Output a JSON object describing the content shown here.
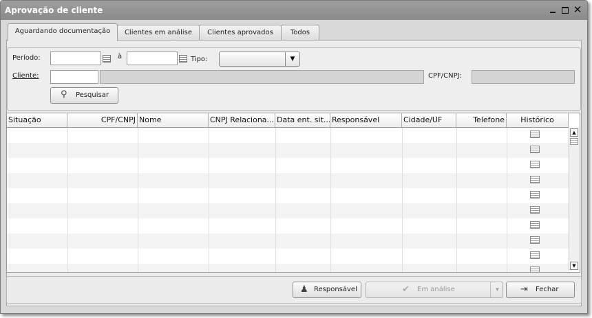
{
  "window": {
    "title": "Aprovação de cliente"
  },
  "tabs": [
    {
      "label": "Aguardando documentação",
      "active": true
    },
    {
      "label": "Clientes em análise"
    },
    {
      "label": "Clientes aprovados"
    },
    {
      "label": "Todos"
    }
  ],
  "filters": {
    "periodo_label": "Período:",
    "ate_label": "à",
    "tipo_label": "Tipo:",
    "cliente_label": "Cliente:",
    "cpfcnpj_label": "CPF/CNPJ:",
    "pesquisar_label": "Pesquisar"
  },
  "grid": {
    "columns": [
      "Situação",
      "CPF/CNPJ",
      "Nome",
      "CNPJ Relaciona...",
      "Data ent. sit...",
      "Responsável",
      "Cidade/UF",
      "Telefone",
      "Histórico"
    ],
    "visible_rows": 10
  },
  "footer": {
    "responsavel_label": "Responsável",
    "em_analise_label": "Em análise",
    "fechar_label": "Fechar"
  },
  "icons": {
    "close": "close-icon",
    "search": "magnifier-icon",
    "calendar": "calendar-icon",
    "historico": "history-list-icon"
  },
  "colors": {
    "titlebar": "#9a9a9a",
    "window_bg": "#d9d9d9"
  }
}
